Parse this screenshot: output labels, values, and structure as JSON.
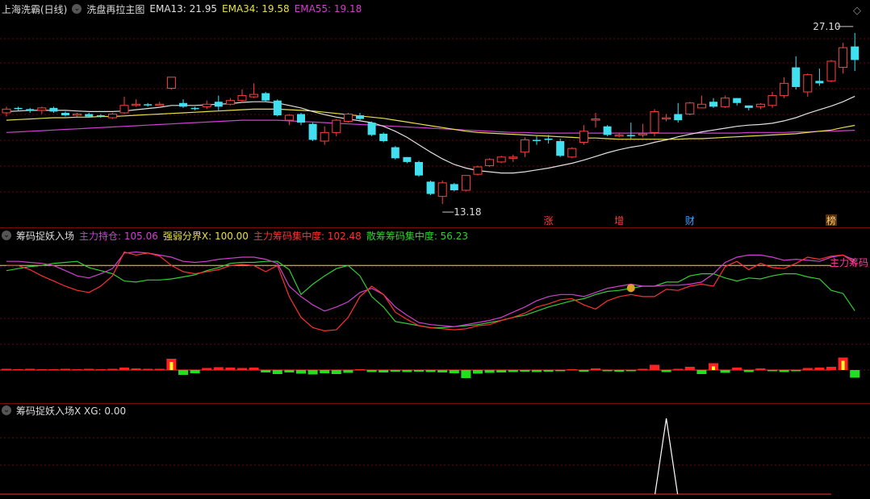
{
  "main": {
    "title": "上海洗霸(日线)",
    "indicator_name": "洗盘再拉主图",
    "ema13": {
      "label": "EMA13: 21.95",
      "color": "#e0e0e0"
    },
    "ema34": {
      "label": "EMA34: 19.58",
      "color": "#e8e04a"
    },
    "ema55": {
      "label": "EMA55: 19.18",
      "color": "#d040d0"
    },
    "high_label": "27.10",
    "low_label": "13.18",
    "signals": [
      "涨",
      "增",
      "财",
      "榜"
    ]
  },
  "sub1": {
    "title": "筹码捉妖入场",
    "s1": {
      "label": "主力持仓: 105.06",
      "color": "#d040d0"
    },
    "s2": {
      "label": "强弱分界X: 100.00",
      "color": "#e8e04a"
    },
    "s3": {
      "label": "主力筹码集中度: 102.48",
      "color": "#ff3030"
    },
    "s4": {
      "label": "散筹筹码集中度: 56.23",
      "color": "#30d030"
    },
    "right_label": "主力筹码"
  },
  "sub2": {
    "title": "筹码捉妖入场X XG: 0.00"
  },
  "colors": {
    "up": "#ff4040",
    "down": "#40e0f0",
    "grid": "#6a0a0a"
  },
  "chart_data": {
    "type": "candlestick",
    "candles": [
      [
        20.6,
        20.9,
        20.3,
        21.1
      ],
      [
        21.0,
        20.9,
        20.8,
        21.1
      ],
      [
        20.9,
        20.8,
        20.6,
        21.0
      ],
      [
        20.8,
        21.0,
        20.5,
        21.1
      ],
      [
        21.0,
        20.7,
        20.6,
        21.1
      ],
      [
        20.6,
        20.4,
        20.3,
        20.7
      ],
      [
        20.4,
        20.5,
        20.3,
        20.6
      ],
      [
        20.5,
        20.3,
        20.2,
        20.6
      ],
      [
        20.4,
        20.3,
        20.2,
        20.5
      ],
      [
        20.2,
        20.5,
        20.1,
        20.6
      ],
      [
        20.6,
        21.2,
        20.5,
        21.9
      ],
      [
        21.2,
        21.3,
        21.1,
        21.7
      ],
      [
        21.3,
        21.2,
        21.1,
        21.4
      ],
      [
        21.3,
        21.3,
        21.2,
        21.5
      ],
      [
        22.6,
        23.5,
        22.5,
        23.5
      ],
      [
        21.4,
        21.1,
        21.0,
        21.7
      ],
      [
        21.0,
        20.9,
        20.8,
        21.1
      ],
      [
        21.1,
        21.3,
        20.9,
        21.6
      ],
      [
        21.5,
        21.1,
        20.8,
        22.0
      ],
      [
        21.3,
        21.6,
        21.2,
        21.8
      ],
      [
        21.6,
        22.0,
        21.4,
        22.5
      ],
      [
        21.9,
        22.1,
        21.8,
        23.0
      ],
      [
        22.2,
        21.6,
        21.5,
        22.3
      ],
      [
        21.6,
        20.4,
        20.3,
        21.7
      ],
      [
        20.0,
        20.4,
        19.6,
        20.5
      ],
      [
        20.5,
        19.8,
        19.6,
        20.6
      ],
      [
        19.7,
        18.4,
        18.3,
        19.8
      ],
      [
        18.3,
        19.0,
        18.0,
        19.5
      ],
      [
        19.0,
        20.0,
        18.7,
        20.1
      ],
      [
        19.9,
        20.5,
        19.8,
        20.6
      ],
      [
        20.4,
        20.1,
        20.0,
        20.6
      ],
      [
        19.8,
        18.8,
        18.7,
        19.9
      ],
      [
        18.9,
        18.3,
        18.2,
        19.0
      ],
      [
        17.8,
        16.9,
        16.8,
        17.9
      ],
      [
        17.0,
        16.6,
        16.5,
        17.0
      ],
      [
        16.6,
        15.5,
        15.4,
        16.7
      ],
      [
        15.0,
        14.0,
        13.9,
        15.1
      ],
      [
        13.8,
        14.9,
        13.18,
        15.1
      ],
      [
        14.8,
        14.3,
        14.2,
        14.9
      ],
      [
        14.3,
        15.5,
        14.2,
        15.5
      ],
      [
        15.6,
        16.2,
        15.5,
        16.3
      ],
      [
        16.3,
        16.8,
        16.2,
        16.9
      ],
      [
        16.6,
        17.0,
        16.5,
        17.1
      ],
      [
        17.0,
        17.0,
        16.6,
        17.2
      ],
      [
        17.4,
        18.4,
        17.0,
        18.6
      ],
      [
        18.4,
        18.3,
        18.0,
        18.7
      ],
      [
        18.5,
        18.4,
        18.1,
        18.8
      ],
      [
        18.3,
        17.1,
        17.0,
        18.5
      ],
      [
        17.0,
        17.7,
        16.9,
        17.8
      ],
      [
        18.2,
        19.1,
        18.0,
        19.6
      ],
      [
        20.0,
        20.1,
        19.4,
        20.6
      ],
      [
        19.5,
        18.8,
        18.7,
        19.6
      ],
      [
        18.8,
        18.8,
        18.6,
        19.0
      ],
      [
        18.8,
        18.7,
        18.5,
        19.8
      ],
      [
        18.8,
        18.9,
        18.6,
        19.7
      ],
      [
        19.0,
        20.7,
        18.7,
        20.9
      ],
      [
        20.2,
        20.2,
        19.9,
        20.5
      ],
      [
        20.5,
        20.0,
        19.8,
        21.4
      ],
      [
        20.5,
        21.4,
        20.4,
        21.5
      ],
      [
        21.0,
        21.3,
        21.0,
        22.0
      ],
      [
        21.5,
        21.1,
        21.0,
        21.8
      ],
      [
        21.1,
        21.8,
        21.0,
        22.0
      ],
      [
        21.8,
        21.4,
        21.2,
        21.8
      ],
      [
        21.2,
        21.0,
        20.8,
        21.2
      ],
      [
        21.1,
        21.3,
        20.9,
        21.4
      ],
      [
        21.2,
        22.0,
        21.0,
        22.3
      ],
      [
        22.0,
        23.0,
        21.8,
        23.5
      ],
      [
        24.3,
        22.7,
        22.5,
        25.2
      ],
      [
        22.3,
        23.7,
        21.9,
        23.8
      ],
      [
        23.2,
        23.0,
        22.8,
        24.2
      ],
      [
        23.2,
        24.8,
        23.1,
        24.9
      ],
      [
        24.3,
        25.9,
        23.8,
        26.3
      ],
      [
        26.0,
        24.9,
        24.0,
        27.1
      ]
    ],
    "ema13": [
      20.7,
      20.75,
      20.8,
      20.8,
      20.8,
      20.8,
      20.75,
      20.7,
      20.7,
      20.7,
      20.75,
      20.85,
      20.95,
      21.05,
      21.2,
      21.2,
      21.2,
      21.25,
      21.3,
      21.35,
      21.45,
      21.5,
      21.5,
      21.4,
      21.2,
      21.0,
      20.7,
      20.45,
      20.25,
      20.1,
      19.95,
      19.8,
      19.5,
      19.1,
      18.6,
      18.0,
      17.4,
      16.85,
      16.4,
      16.1,
      15.9,
      15.8,
      15.7,
      15.7,
      15.8,
      15.95,
      16.1,
      16.3,
      16.5,
      16.75,
      17.05,
      17.35,
      17.6,
      17.8,
      17.95,
      18.2,
      18.4,
      18.65,
      18.85,
      19.05,
      19.2,
      19.35,
      19.5,
      19.6,
      19.65,
      19.75,
      19.95,
      20.2,
      20.55,
      20.85,
      21.15,
      21.5,
      21.95
    ],
    "ema34": [
      20.0,
      20.05,
      20.1,
      20.15,
      20.2,
      20.2,
      20.25,
      20.25,
      20.3,
      20.3,
      20.35,
      20.4,
      20.45,
      20.5,
      20.55,
      20.6,
      20.65,
      20.7,
      20.75,
      20.8,
      20.85,
      20.9,
      20.9,
      20.9,
      20.85,
      20.8,
      20.75,
      20.65,
      20.55,
      20.45,
      20.35,
      20.25,
      20.15,
      20.0,
      19.85,
      19.7,
      19.55,
      19.4,
      19.25,
      19.1,
      19.0,
      18.95,
      18.9,
      18.85,
      18.8,
      18.75,
      18.7,
      18.65,
      18.6,
      18.55,
      18.55,
      18.5,
      18.45,
      18.45,
      18.45,
      18.45,
      18.45,
      18.45,
      18.5,
      18.5,
      18.55,
      18.6,
      18.65,
      18.7,
      18.75,
      18.8,
      18.85,
      18.9,
      19.0,
      19.1,
      19.2,
      19.4,
      19.58
    ],
    "ema55": [
      19.0,
      19.05,
      19.1,
      19.15,
      19.2,
      19.25,
      19.3,
      19.35,
      19.4,
      19.45,
      19.5,
      19.55,
      19.6,
      19.65,
      19.7,
      19.75,
      19.8,
      19.85,
      19.9,
      19.95,
      20.0,
      20.0,
      20.0,
      20.0,
      19.95,
      19.9,
      19.85,
      19.8,
      19.75,
      19.7,
      19.65,
      19.6,
      19.55,
      19.5,
      19.45,
      19.4,
      19.35,
      19.3,
      19.25,
      19.2,
      19.15,
      19.1,
      19.05,
      19.0,
      19.0,
      18.95,
      18.95,
      18.95,
      18.95,
      18.95,
      18.95,
      18.95,
      18.95,
      18.95,
      18.95,
      18.95,
      18.95,
      18.95,
      18.95,
      18.95,
      18.95,
      18.95,
      18.95,
      19.0,
      19.0,
      19.0,
      19.0,
      19.05,
      19.05,
      19.1,
      19.1,
      19.15,
      19.18
    ],
    "main_force": [
      104,
      104,
      103,
      102,
      100,
      95,
      90,
      88,
      92,
      97,
      112,
      113,
      112,
      110,
      108,
      104,
      103,
      104,
      106,
      107,
      108,
      108,
      106,
      102,
      80,
      70,
      62,
      56,
      60,
      65,
      74,
      78,
      72,
      60,
      52,
      45,
      43,
      42,
      41,
      43,
      45,
      47,
      50,
      55,
      60,
      66,
      70,
      72,
      72,
      70,
      74,
      78,
      80,
      82,
      80,
      80,
      81,
      81,
      82,
      84,
      92,
      103,
      108,
      110,
      110,
      108,
      105,
      106,
      105,
      104,
      108,
      110,
      105.06
    ],
    "main_chip": [
      100,
      100,
      96,
      90,
      85,
      80,
      76,
      74,
      80,
      90,
      113,
      110,
      112,
      109,
      100,
      94,
      92,
      94,
      96,
      100,
      101,
      100,
      94,
      100,
      70,
      50,
      40,
      37,
      38,
      50,
      70,
      80,
      72,
      55,
      48,
      42,
      40,
      39,
      38,
      39,
      42,
      43,
      47,
      50,
      54,
      60,
      63,
      67,
      68,
      62,
      58,
      66,
      70,
      72,
      70,
      70,
      77,
      76,
      80,
      82,
      80,
      99,
      104,
      96,
      102,
      98,
      97,
      102,
      108,
      106,
      109,
      110,
      102.48
    ],
    "retail_chip": [
      95,
      97,
      99,
      100,
      102,
      103,
      104,
      98,
      95,
      92,
      85,
      84,
      86,
      86,
      87,
      89,
      91,
      95,
      98,
      102,
      103,
      103,
      104,
      104,
      96,
      72,
      82,
      90,
      97,
      100,
      90,
      70,
      60,
      46,
      44,
      42,
      40,
      40,
      41,
      42,
      43,
      45,
      47,
      50,
      52,
      56,
      60,
      63,
      66,
      68,
      72,
      75,
      76,
      78,
      80,
      80,
      84,
      84,
      90,
      92,
      92,
      88,
      85,
      88,
      87,
      90,
      92,
      92,
      89,
      87,
      76,
      73,
      56.23
    ],
    "volume_bars": [
      0.3,
      0.2,
      0.3,
      0.2,
      0.2,
      0.3,
      0.2,
      0.3,
      0.2,
      0.3,
      0.6,
      0.4,
      0.3,
      0.3,
      2.8,
      -1.2,
      -0.8,
      0.5,
      0.7,
      0.6,
      0.5,
      0.6,
      -0.6,
      -1.0,
      -0.6,
      -0.9,
      -1.1,
      -0.8,
      -1.0,
      -0.7,
      0.2,
      -0.5,
      -0.6,
      -0.4,
      -0.5,
      -0.4,
      -0.5,
      -0.6,
      -0.8,
      -2.0,
      -0.9,
      -0.7,
      -0.6,
      -0.5,
      -0.4,
      -0.5,
      -0.4,
      -0.3,
      0.2,
      -0.4,
      0.4,
      -0.3,
      -0.4,
      -0.3,
      0.3,
      1.3,
      -0.5,
      0.3,
      0.8,
      -1.0,
      1.7,
      -0.7,
      0.6,
      -0.5,
      0.4,
      -0.3,
      -0.5,
      -0.3,
      0.5,
      0.6,
      0.8,
      3.1,
      -1.9,
      0.8,
      2.6,
      -0.4,
      0.4,
      3.5,
      7.0,
      -5.0
    ],
    "xg": [
      0,
      0,
      0,
      0,
      0,
      0,
      0,
      0,
      0,
      0,
      0,
      0,
      0,
      0,
      0,
      0,
      0,
      0,
      0,
      0,
      0,
      0,
      0,
      0,
      0,
      0,
      0,
      0,
      0,
      0,
      0,
      0,
      0,
      0,
      0,
      0,
      0,
      0,
      0,
      0,
      0,
      0,
      0,
      0,
      0,
      0,
      0,
      0,
      0,
      0,
      0,
      0,
      0,
      0,
      0,
      0,
      1,
      0,
      0,
      0,
      0,
      0,
      0,
      0,
      0,
      0,
      0,
      0,
      0,
      0,
      0,
      0,
      0
    ]
  }
}
